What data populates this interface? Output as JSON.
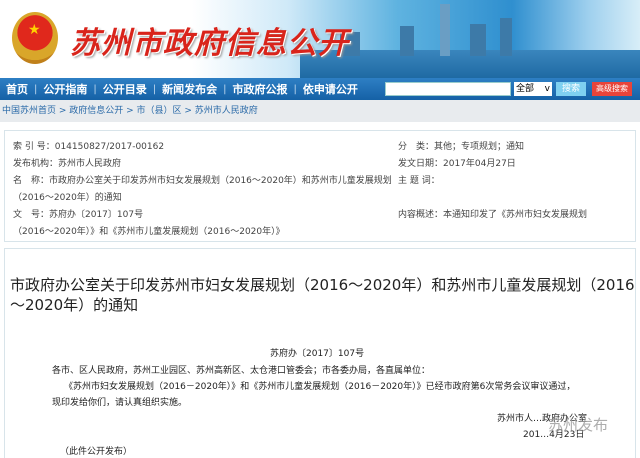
{
  "header": {
    "site_title": "苏州市政府信息公开"
  },
  "nav": {
    "items": [
      "首页",
      "公开指南",
      "公开目录",
      "新闻发布会",
      "市政府公报",
      "依申请公开"
    ],
    "search_placeholder": "",
    "scope_select": "全部",
    "search_button": "搜索",
    "advanced_search_button": "高级搜索"
  },
  "breadcrumb": "中国苏州首页 > 政府信息公开 > 市（县）区 > 苏州市人民政府",
  "meta": {
    "index_no": "索 引 号：014150827/2017-00162",
    "publisher": "发布机构：苏州市人民政府",
    "name_1": "名　称：市政府办公室关于印发苏州市妇女发展规划（2016～2020年）和苏州市儿童发展规划",
    "name_2": "（2016～2020年）的通知",
    "doc_no": "文　号：苏府办〔2017〕107号",
    "category": "分　类：其他；专项规划；通知",
    "date": "发文日期：2017年04月27日",
    "keywords": "主 题 词：",
    "summary": "内容概述：本通知印发了《苏州市妇女发展规划",
    "summary_2": "（2016～2020年）》和《苏州市儿童发展规划（2016～2020年）》"
  },
  "document": {
    "title": "市政府办公室关于印发苏州市妇女发展规划（2016～2020年）和苏州市儿童发展规划（2016～2020年）的通知",
    "doc_number": "苏府办〔2017〕107号",
    "recipients": "各市、区人民政府，苏州工业园区、苏州高新区、太仓港口管委会；市各委办局，各直属单位：",
    "body_1": "《苏州市妇女发展规划（2016－2020年）》和《苏州市儿童发展规划（2016－2020年）》已经市政府第6次常务会议审议通过，",
    "body_2": "现印发给你们，请认真组织实施。",
    "signature": "苏州市人…政府办公室",
    "sign_date": "201…4月23日",
    "footnote": "（此件公开发布）"
  },
  "watermark": "苏州发布"
}
